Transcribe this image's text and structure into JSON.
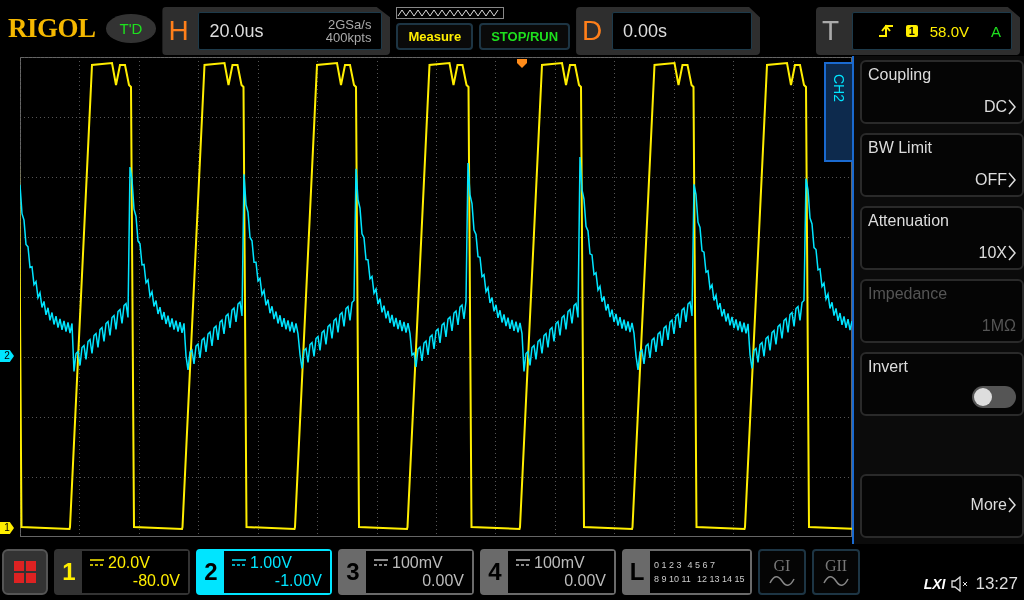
{
  "top_bar": {
    "logo": "RIGOL",
    "run_state": "T'D",
    "horizontal": {
      "label": "H",
      "timebase": "20.0us",
      "sample_rate": "2GSa/s",
      "memory": "400kpts"
    },
    "buttons": [
      {
        "label": "Measure",
        "kind": "measure"
      },
      {
        "label": "STOP/RUN",
        "kind": "run"
      }
    ],
    "delay": {
      "label": "D",
      "value": "0.00s"
    },
    "trigger": {
      "label": "T",
      "source": "1",
      "level": "58.0V",
      "mode": "A"
    }
  },
  "markers": [
    {
      "label": "2",
      "color": "#00e5ff"
    },
    {
      "label": "1",
      "color": "#ffee00"
    }
  ],
  "side_menu": {
    "title": "CH2",
    "items": [
      {
        "label": "Coupling",
        "value": "DC",
        "kind": "select",
        "disabled": false
      },
      {
        "label": "BW Limit",
        "value": "OFF",
        "kind": "select",
        "disabled": false
      },
      {
        "label": "Attenuation",
        "value": "10X",
        "kind": "select",
        "disabled": false
      },
      {
        "label": "Impedance",
        "value": "1MΩ",
        "kind": "value",
        "disabled": true
      },
      {
        "label": "Invert",
        "kind": "toggle",
        "on": false,
        "disabled": false
      },
      {
        "label": "More",
        "kind": "more",
        "disabled": false
      }
    ]
  },
  "channels": [
    {
      "number": "1",
      "scale": "20.0V",
      "offset": "-80.0V",
      "on": true,
      "selected": false,
      "color": "#ffee00"
    },
    {
      "number": "2",
      "scale": "1.00V",
      "offset": "-1.00V",
      "on": true,
      "selected": true,
      "color": "#00e5ff"
    },
    {
      "number": "3",
      "scale": "100mV",
      "offset": "0.00V",
      "on": false,
      "selected": false
    },
    {
      "number": "4",
      "scale": "100mV",
      "offset": "0.00V",
      "on": false,
      "selected": false
    }
  ],
  "logic": {
    "label": "L",
    "rows": [
      [
        "0 1 2 3",
        "4 5 6 7"
      ],
      [
        "8 9 10 11",
        "12 13 14 15"
      ]
    ]
  },
  "generators": [
    "GI",
    "GII"
  ],
  "status": {
    "lxi": "LXI",
    "time": "13:27"
  }
}
